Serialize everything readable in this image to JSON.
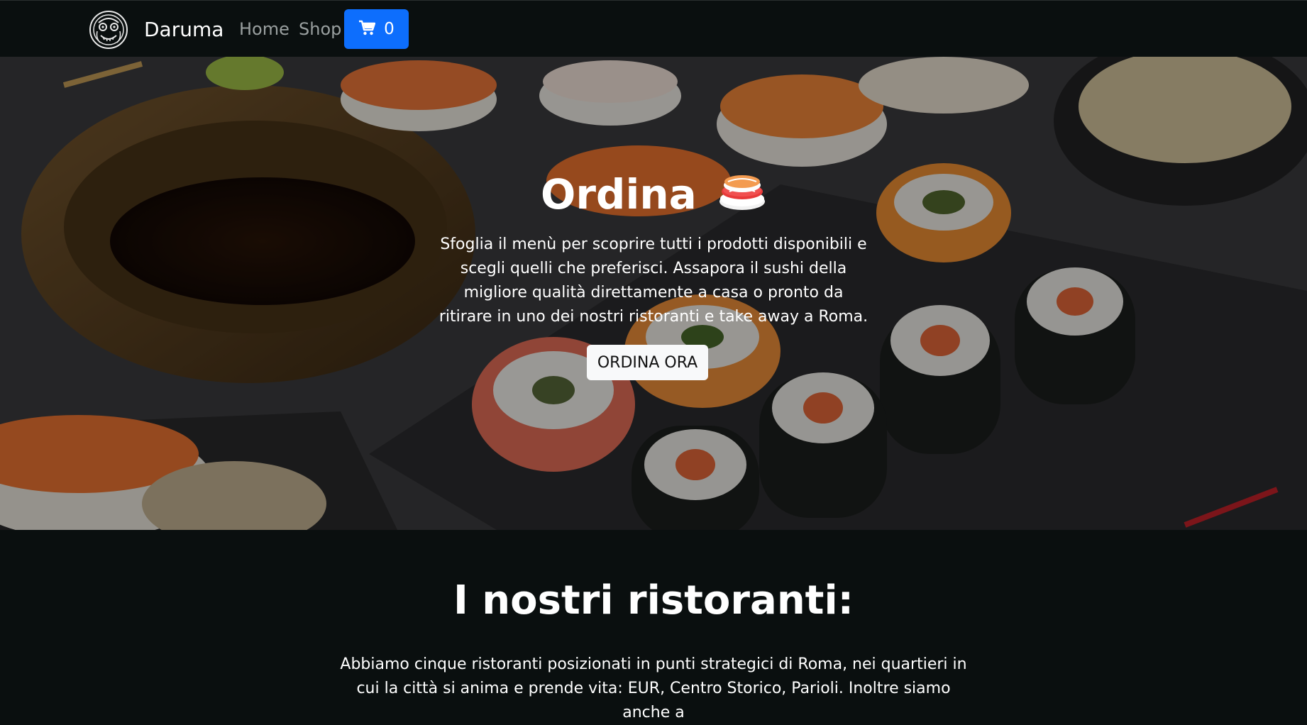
{
  "navbar": {
    "brand": "Daruma",
    "links": [
      {
        "label": "Home"
      },
      {
        "label": "Shop"
      }
    ],
    "cart_count": "0",
    "colors": {
      "background": "#0a0f0f",
      "cart_button": "#0d6efd"
    }
  },
  "hero": {
    "title": "Ordina",
    "description": "Sfoglia il menù per scoprire tutti i prodotti disponibili e scegli quelli che preferisci. Assapora il sushi della migliore qualità direttamente a casa o pronto da ritirare in uno dei nostri ristoranti e take away a Roma.",
    "cta_label": "ORDINA ORA"
  },
  "restaurants": {
    "title": "I nostri ristoranti:",
    "text": "Abbiamo cinque ristoranti posizionati in punti strategici di Roma, nei quartieri in cui la città si anima e prende vita: EUR, Centro Storico, Parioli. Inoltre siamo anche a"
  },
  "icons": {
    "logo": "daruma-logo-icon",
    "cart": "cart-icon",
    "sushi": "sushi-icon"
  }
}
